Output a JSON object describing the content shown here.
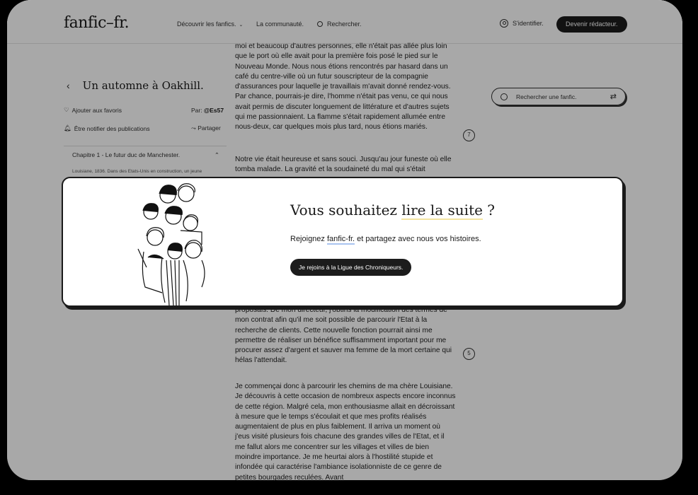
{
  "header": {
    "logo": "fanfic–fr.",
    "nav": {
      "discover": "Découvrir les fanfics.",
      "community": "La communauté.",
      "search": "Rechercher."
    },
    "login": "S'identifier.",
    "become_writer": "Devenir rédacteur."
  },
  "story": {
    "title": "Un automne à Oakhill.",
    "favorite": "Ajouter aux favoris",
    "author_label": "Par:",
    "author": "@Es57",
    "notify": "Être notifier des publications",
    "share": "Partager",
    "chapter": "Chapitre 1 - Le futur duc de Manchester.",
    "chapter_excerpt": "Louisiane, 1836. Dans des Etats-Unis en construction, un jeune"
  },
  "article": {
    "para1": "moi et beaucoup d'autres personnes, elle n'était pas allée plus loin que le port où elle avait pour la première fois posé le pied sur le Nouveau Monde. Nous nous étions rencontrés par hasard dans un café du centre-ville où un futur souscripteur de la compagnie d'assurances pour laquelle je travaillais m'avait donné rendez-vous. Par chance, pourrais-je dire, l'homme n'était pas venu, ce qui nous avait permis de discuter longuement de littérature et d'autres sujets qui me passionnaient. La flamme s'était rapidement allumée entre nous-deux, car quelques mois plus tard, nous étions mariés.",
    "para2": "Notre vie était heureuse et sans souci. Jusqu'au jour funeste où elle tomba malade. La gravité et la soudaineté du mal qui s'était",
    "para3": "proposais. De mon directeur, j'obtins la modification des termes de mon contrat afin qu'il me soit possible de parcourir l'Etat à la recherche de clients. Cette nouvelle fonction pourrait ainsi me permettre de réaliser un bénéfice suffisamment important pour me procurer assez d'argent et sauver ma femme de la mort certaine qui hélas l'attendait.",
    "para4": "Je commençai donc à parcourir les chemins de ma chère Louisiane. Je découvris à cette occasion de nombreux aspects encore inconnus de cette région. Malgré cela, mon enthousiasme allait en décroissant à mesure que le temps s'écoulait et que mes profits réalisés augmentaient de plus en plus faiblement. Il arriva un moment où j'eus visité plusieurs fois chacune des grandes villes de l'Etat, et il me fallut alors me concentrer sur les villages et villes de bien moindre importance. Je me heurtai alors à l'hostilité stupide et infondée qui caractérise l'ambiance isolationniste de ce genre de petites bourgades reculées. Avant",
    "comment_count_1": "7",
    "comment_count_2": "5"
  },
  "sidebar_search": {
    "placeholder": "Rechercher une fanfic."
  },
  "modal": {
    "title_prefix": "Vous souhaitez ",
    "title_highlight": "lire la suite",
    "title_suffix": " ?",
    "text_prefix": "Rejoignez ",
    "text_brand": "fanfic-fr.",
    "text_suffix": " et partagez avec nous vos histoires.",
    "button": "Je rejoins à la Ligue des Chroniqueurs."
  },
  "colors": {
    "button_bg": "#1c1c1c",
    "highlight_yellow": "#f3e4a0",
    "highlight_blue": "#a9c4f0"
  }
}
